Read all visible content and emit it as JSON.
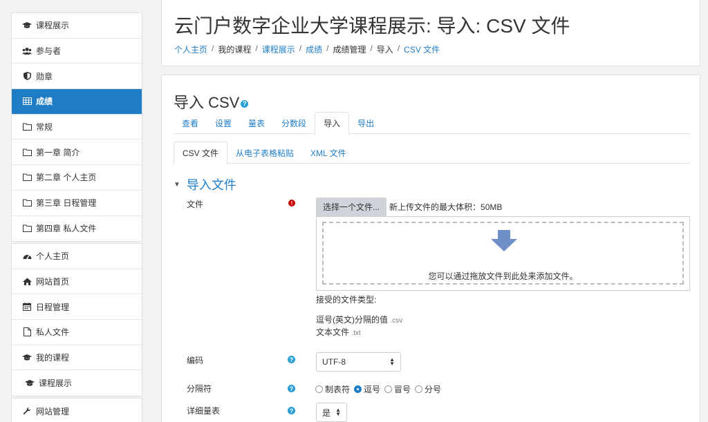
{
  "sidebar": {
    "group1": [
      {
        "label": "课程展示",
        "icon": "graduation-cap-icon"
      },
      {
        "label": "参与者",
        "icon": "users-icon"
      },
      {
        "label": "勋章",
        "icon": "shield-icon"
      },
      {
        "label": "成绩",
        "icon": "table-icon"
      },
      {
        "label": "常规",
        "icon": "folder-icon"
      },
      {
        "label": "第一章 简介",
        "icon": "folder-icon"
      },
      {
        "label": "第二章 个人主页",
        "icon": "folder-icon"
      },
      {
        "label": "第三章 日程管理",
        "icon": "folder-icon"
      },
      {
        "label": "第四章 私人文件",
        "icon": "folder-icon"
      }
    ],
    "active_index": 3,
    "group2": [
      {
        "label": "个人主页",
        "icon": "dashboard-icon"
      },
      {
        "label": "网站首页",
        "icon": "home-icon"
      },
      {
        "label": "日程管理",
        "icon": "calendar-icon"
      },
      {
        "label": "私人文件",
        "icon": "file-icon"
      },
      {
        "label": "我的课程",
        "icon": "graduation-cap-icon"
      },
      {
        "label": "课程展示",
        "icon": "graduation-cap-icon"
      }
    ],
    "group3": [
      {
        "label": "网站管理",
        "icon": "wrench-icon"
      }
    ]
  },
  "header": {
    "title": "云门户数字企业大学课程展示: 导入: CSV 文件",
    "breadcrumb": [
      {
        "label": "个人主页",
        "link": true
      },
      {
        "label": "我的课程",
        "link": false
      },
      {
        "label": "课程展示",
        "link": true
      },
      {
        "label": "成绩",
        "link": true
      },
      {
        "label": "成绩管理",
        "link": false
      },
      {
        "label": "导入",
        "link": false
      },
      {
        "label": "CSV 文件",
        "link": true
      }
    ]
  },
  "main": {
    "heading": "导入 CSV",
    "tabs": [
      "查看",
      "设置",
      "量表",
      "分数段",
      "导入",
      "导出"
    ],
    "active_tab": 4,
    "subtabs": [
      "CSV 文件",
      "从电子表格粘贴",
      "XML 文件"
    ],
    "active_subtab": 0,
    "legend": "导入文件",
    "file": {
      "label": "文件",
      "button": "选择一个文件...",
      "max_size": "新上传文件的最大体积：50MB",
      "drop_text": "您可以通过拖放文件到此处来添加文件。",
      "accepted_label": "接受的文件类型:",
      "types": [
        {
          "name": "逗号(英文)分隔的值",
          "ext": ".csv"
        },
        {
          "name": "文本文件",
          "ext": ".txt"
        }
      ]
    },
    "encoding": {
      "label": "编码",
      "value": "UTF-8"
    },
    "separator": {
      "label": "分隔符",
      "options": [
        "制表符",
        "逗号",
        "冒号",
        "分号"
      ],
      "selected": 1
    },
    "verbose": {
      "label": "详细量表",
      "value": "是"
    }
  },
  "colors": {
    "accent": "#1f7dc6",
    "required": "#cc0000",
    "help": "#2a9fd6"
  }
}
